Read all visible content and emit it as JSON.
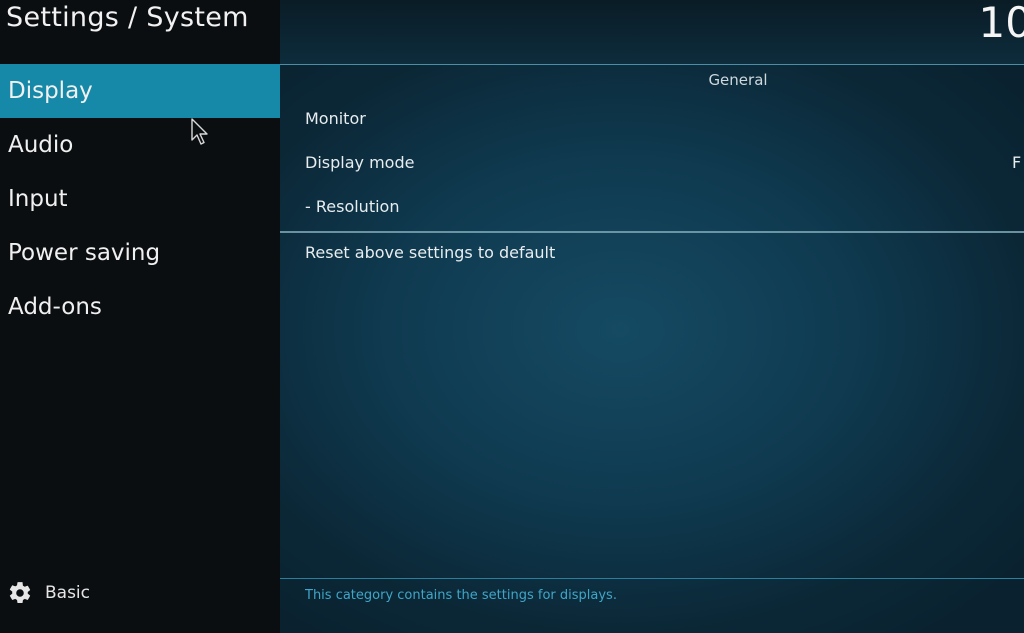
{
  "header": {
    "title": "Settings / System",
    "clock": "10"
  },
  "sidebar": {
    "items": [
      {
        "label": "Display",
        "active": true
      },
      {
        "label": "Audio",
        "active": false
      },
      {
        "label": "Input",
        "active": false
      },
      {
        "label": "Power saving",
        "active": false
      },
      {
        "label": "Add-ons",
        "active": false
      }
    ],
    "mode": {
      "icon": "gear-icon",
      "label": "Basic"
    }
  },
  "content": {
    "group_header": "General",
    "rows": [
      {
        "label": "Monitor",
        "value": ""
      },
      {
        "label": "Display mode",
        "value": "F"
      },
      {
        "label": "- Resolution",
        "value": ""
      },
      {
        "label": "Reset above settings to default",
        "value": ""
      }
    ],
    "description": "This category contains the settings for displays."
  },
  "colors": {
    "accent": "#1688a8",
    "sidebar_bg": "#0b0e11",
    "description_text": "#3fa6c8"
  }
}
